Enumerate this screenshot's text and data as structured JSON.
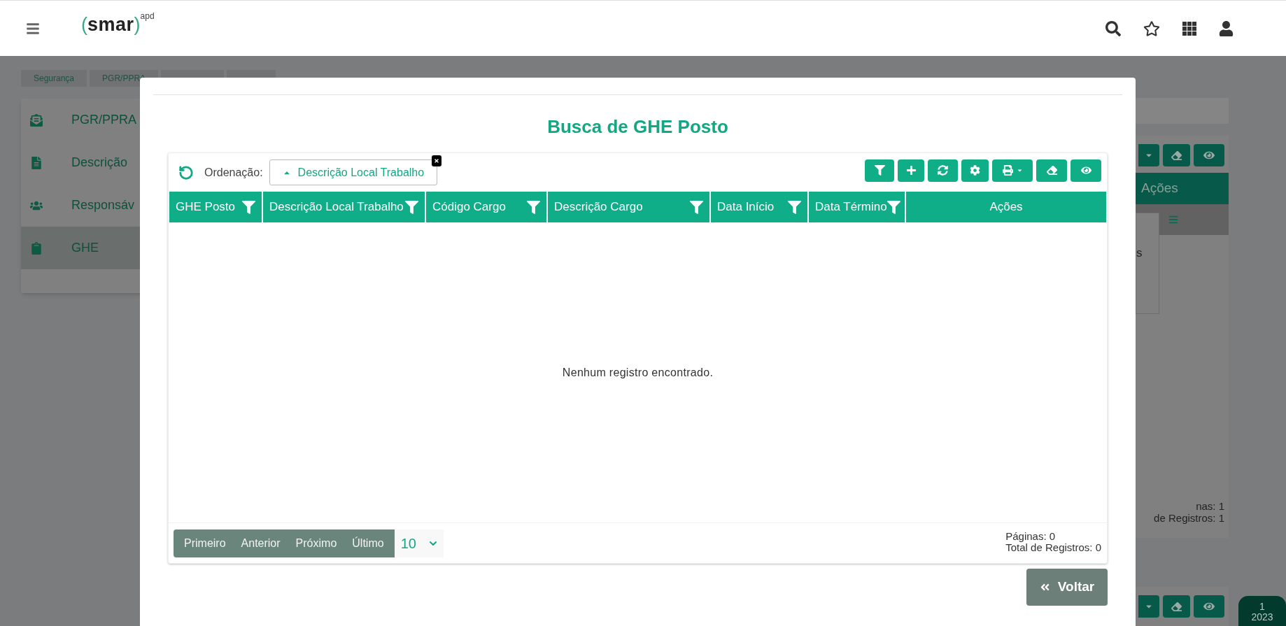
{
  "header": {
    "logo": {
      "open": "(",
      "name": "smar",
      "close": ")",
      "superscript": "apd"
    }
  },
  "breadcrumb": [
    "Segurança",
    "PGR/PPRA"
  ],
  "sidebar": {
    "items": [
      {
        "label": "PGR/PPRA",
        "kind": "envelope",
        "selected": false
      },
      {
        "label": "Descrição",
        "kind": "document",
        "selected": false
      },
      {
        "label": "Responsáv",
        "kind": "people",
        "selected": false
      },
      {
        "label": "GHE",
        "kind": "clipboard",
        "selected": true
      }
    ]
  },
  "background_panel": {
    "header": "Ações",
    "popup_text": "s",
    "footer": [
      "nas: 1",
      "de Registros: 1"
    ]
  },
  "year_tab": [
    "1",
    "2023"
  ],
  "modal": {
    "title": "Busca de GHE Posto",
    "sort_label": "Ordenação:",
    "sort_chip": {
      "label": "Descrição Local Trabalho"
    },
    "toolbar": [
      {
        "kind": "filter"
      },
      {
        "kind": "add"
      },
      {
        "kind": "refresh"
      },
      {
        "kind": "settings"
      },
      {
        "kind": "print"
      },
      {
        "kind": "clear"
      },
      {
        "kind": "view"
      }
    ],
    "table": {
      "columns": [
        {
          "label": "GHE Posto",
          "filterable": true
        },
        {
          "label": "Descrição Local Trabalho",
          "filterable": true
        },
        {
          "label": "Código Cargo",
          "filterable": true
        },
        {
          "label": "Descrição Cargo",
          "filterable": true
        },
        {
          "label": "Data Início",
          "filterable": true
        },
        {
          "label": "Data Término",
          "filterable": true
        },
        {
          "label": "Ações",
          "filterable": false
        }
      ],
      "empty_message": "Nenhum registro encontrado."
    },
    "pagination": [
      "Primeiro",
      "Anterior",
      "Próximo",
      "Último"
    ],
    "page_size": "10",
    "pages": "Páginas: 0",
    "total": "Total de Registros: 0",
    "back_button": "Voltar"
  }
}
